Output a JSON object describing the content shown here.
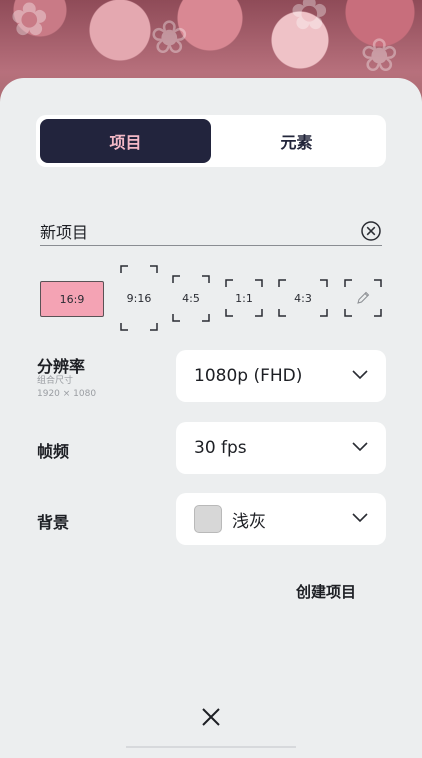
{
  "tabs": [
    {
      "label": "项目",
      "active": true
    },
    {
      "label": "元素",
      "active": false
    }
  ],
  "project_name": {
    "value": "新项目"
  },
  "aspect_ratios": [
    {
      "label": "16:9",
      "selected": true
    },
    {
      "label": "9:16",
      "selected": false
    },
    {
      "label": "4:5",
      "selected": false
    },
    {
      "label": "1:1",
      "selected": false
    },
    {
      "label": "4:3",
      "selected": false
    },
    {
      "label": "",
      "icon": "pencil-icon",
      "selected": false
    }
  ],
  "resolution": {
    "label": "分辨率",
    "sub_label": "组合尺寸",
    "dimensions": "1920 × 1080",
    "value": "1080p (FHD)"
  },
  "frame_rate": {
    "label": "帧频",
    "value": "30 fps"
  },
  "background": {
    "label": "背景",
    "value": "浅灰",
    "swatch_color": "#d7d7d7"
  },
  "create_button": {
    "label": "创建项目"
  },
  "colors": {
    "active_tab_bg": "#22243d",
    "active_tab_text": "#f3b8c6",
    "selected_ratio_bg": "#f4a3b4",
    "sheet_bg": "#eceeef"
  }
}
